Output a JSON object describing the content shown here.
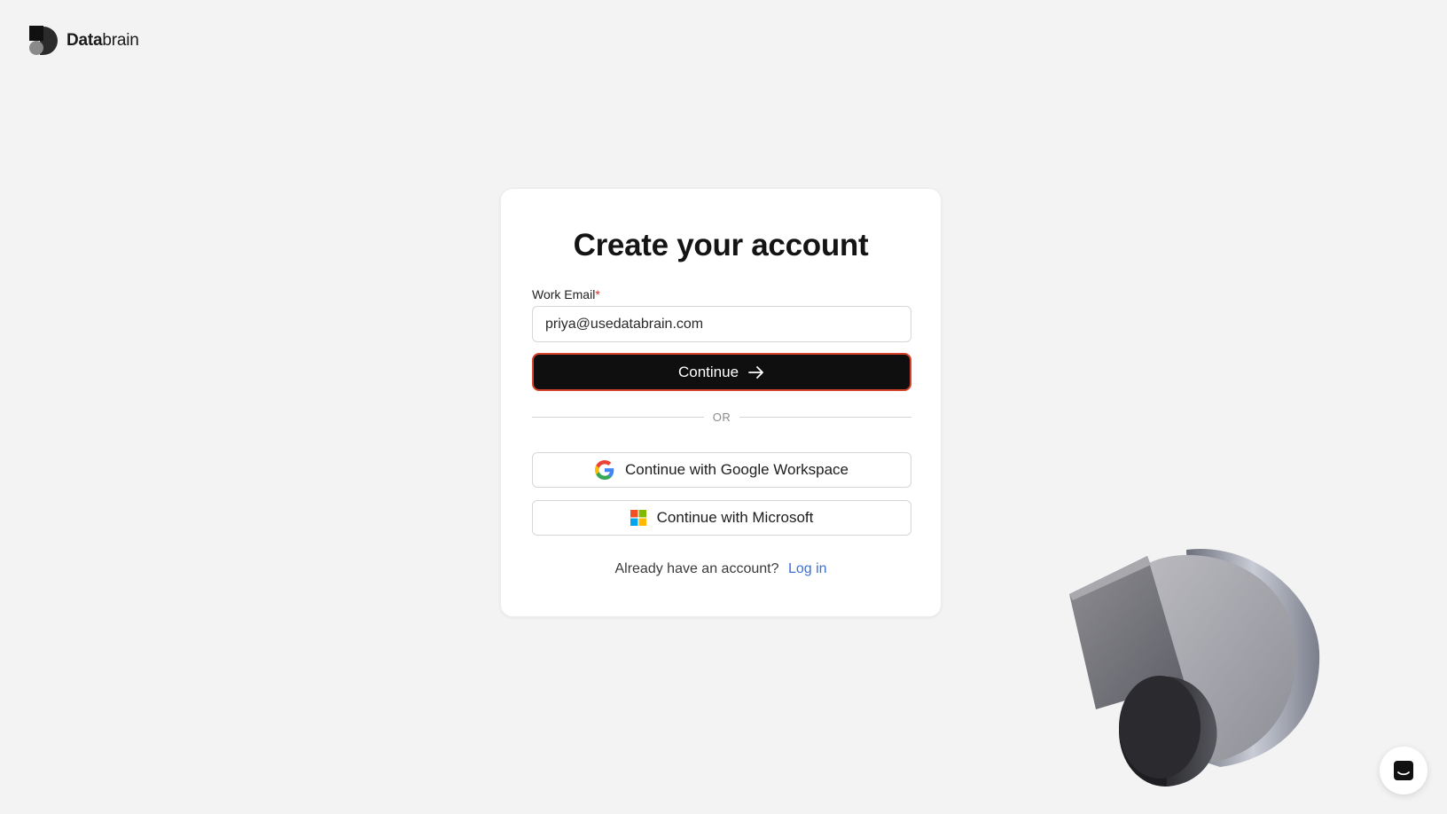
{
  "brand": {
    "bold": "Data",
    "regular": "brain"
  },
  "card": {
    "title": "Create your account",
    "email_label": "Work Email",
    "required_mark": "*",
    "email_value": "priya@usedatabrain.com",
    "continue_label": "Continue",
    "divider_text": "OR",
    "google_label": "Continue with Google Workspace",
    "microsoft_label": "Continue with Microsoft",
    "login_prompt": "Already have an account?",
    "login_link": "Log in"
  },
  "colors": {
    "background": "#f3f3f3",
    "primary_button": "#0f0f0f",
    "focus_outline": "#d8432b",
    "link": "#3b6fd6",
    "required": "#d93025"
  },
  "icons": {
    "logo": "databrain-logo-icon",
    "continue_arrow": "arrow-right-icon",
    "google": "google-g-icon",
    "microsoft": "microsoft-logo-icon",
    "chat": "chat-launcher-icon"
  }
}
